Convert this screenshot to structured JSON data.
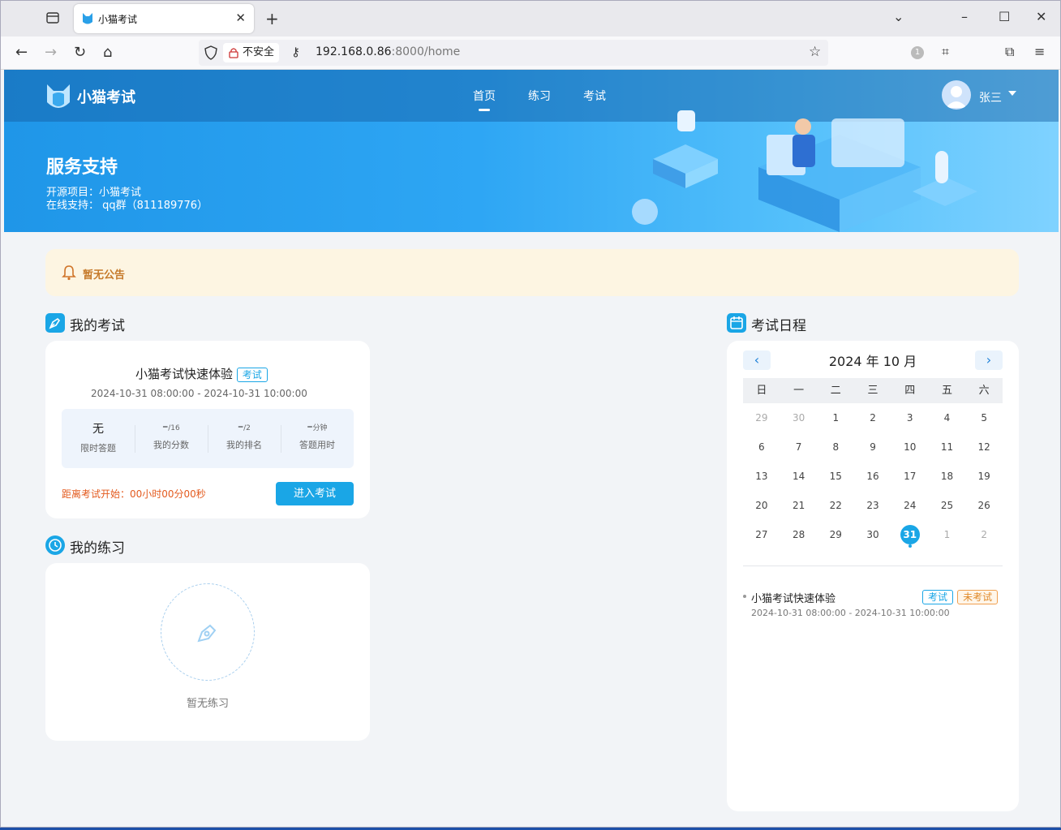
{
  "browser": {
    "tab_title": "小猫考试",
    "insecure_label": "不安全",
    "url_host": "192.168.0.86",
    "url_rest": ":8000/home",
    "badge_count": "1"
  },
  "app": {
    "brand": "小猫考试",
    "menu": [
      "首页",
      "练习",
      "考试"
    ],
    "user_name": "张三"
  },
  "hero": {
    "title": "服务支持",
    "line1": "开源项目：小猫考试",
    "line2": "在线支持： qq群（811189776）"
  },
  "notice": {
    "text": "暂无公告"
  },
  "my_exam": {
    "section_title": "我的考试",
    "name": "小猫考试快速体验",
    "tag": "考试",
    "time_range": "2024-10-31 08:00:00 - 2024-10-31 10:00:00",
    "stats": [
      {
        "value": "无",
        "suffix": "",
        "label": "限时答题"
      },
      {
        "value": "–",
        "suffix": "/16",
        "label": "我的分数"
      },
      {
        "value": "–",
        "suffix": "/2",
        "label": "我的排名"
      },
      {
        "value": "–",
        "suffix": "分钟",
        "label": "答题用时"
      }
    ],
    "countdown": "距离考试开始：00小时00分00秒",
    "enter_button": "进入考试"
  },
  "my_practice": {
    "section_title": "我的练习",
    "empty_text": "暂无练习"
  },
  "schedule": {
    "section_title": "考试日程",
    "month_label": "2024 年 10 月",
    "weekdays": [
      "日",
      "一",
      "二",
      "三",
      "四",
      "五",
      "六"
    ],
    "weeks": [
      [
        "29",
        "30",
        "1",
        "2",
        "3",
        "4",
        "5"
      ],
      [
        "6",
        "7",
        "8",
        "9",
        "10",
        "11",
        "12"
      ],
      [
        "13",
        "14",
        "15",
        "16",
        "17",
        "18",
        "19"
      ],
      [
        "20",
        "21",
        "22",
        "23",
        "24",
        "25",
        "26"
      ],
      [
        "27",
        "28",
        "29",
        "30",
        "31",
        "1",
        "2"
      ]
    ],
    "today": "31",
    "event": {
      "name": "小猫考试快速体验",
      "tag1": "考试",
      "tag2": "未考试",
      "time_range": "2024-10-31 08:00:00 - 2024-10-31 10:00:00"
    }
  },
  "colors": {
    "accent": "#1aa6e6",
    "notice_bg": "#fdf5e2",
    "countdown": "#e35a1e"
  }
}
